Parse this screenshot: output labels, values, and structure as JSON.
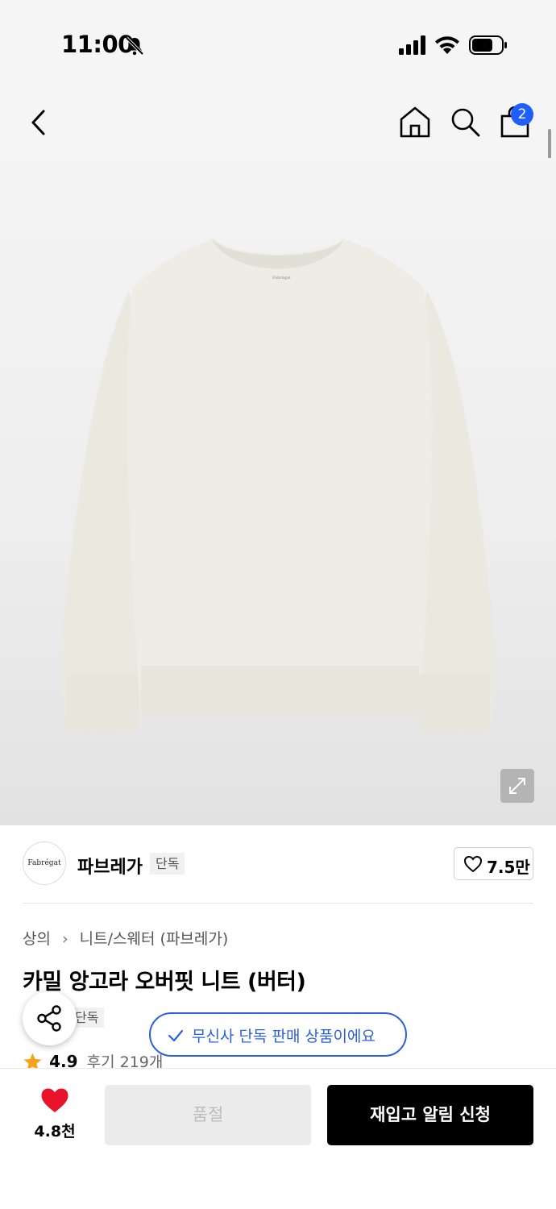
{
  "status_bar": {
    "time": "11:00",
    "icons": [
      "bell-slash-icon",
      "signal-icon",
      "wifi-icon",
      "battery-icon"
    ]
  },
  "nav": {
    "icons": [
      "back-icon",
      "home-icon",
      "search-icon",
      "shopping-bag-icon"
    ],
    "cart_count": "2",
    "badge_color": "#1f5eff"
  },
  "product_image": {
    "subject": "sweater",
    "expand_icon": "expand-icon"
  },
  "brand": {
    "logo_text": "Fabrégat",
    "name": "파브레가",
    "exclusive_tag": "단독",
    "like_count": "7.5만"
  },
  "breadcrumb": {
    "category": "상의",
    "subcategory": "니트/스웨터",
    "brand": "(파브레가)"
  },
  "product": {
    "title": "카밀 앙고라 오버핏 니트 (버터)",
    "exclusive_tag": "단독",
    "rating": "4.9",
    "review_label": "후기 219개"
  },
  "toast": {
    "text": "무신사 단독 판매 상품이에요",
    "color": "#2b5fe0"
  },
  "bottom_bar": {
    "heart_count": "4.8천",
    "heart_color": "#e8142b",
    "soldout_label": "품절",
    "restock_label": "재입고 알림 신청"
  }
}
